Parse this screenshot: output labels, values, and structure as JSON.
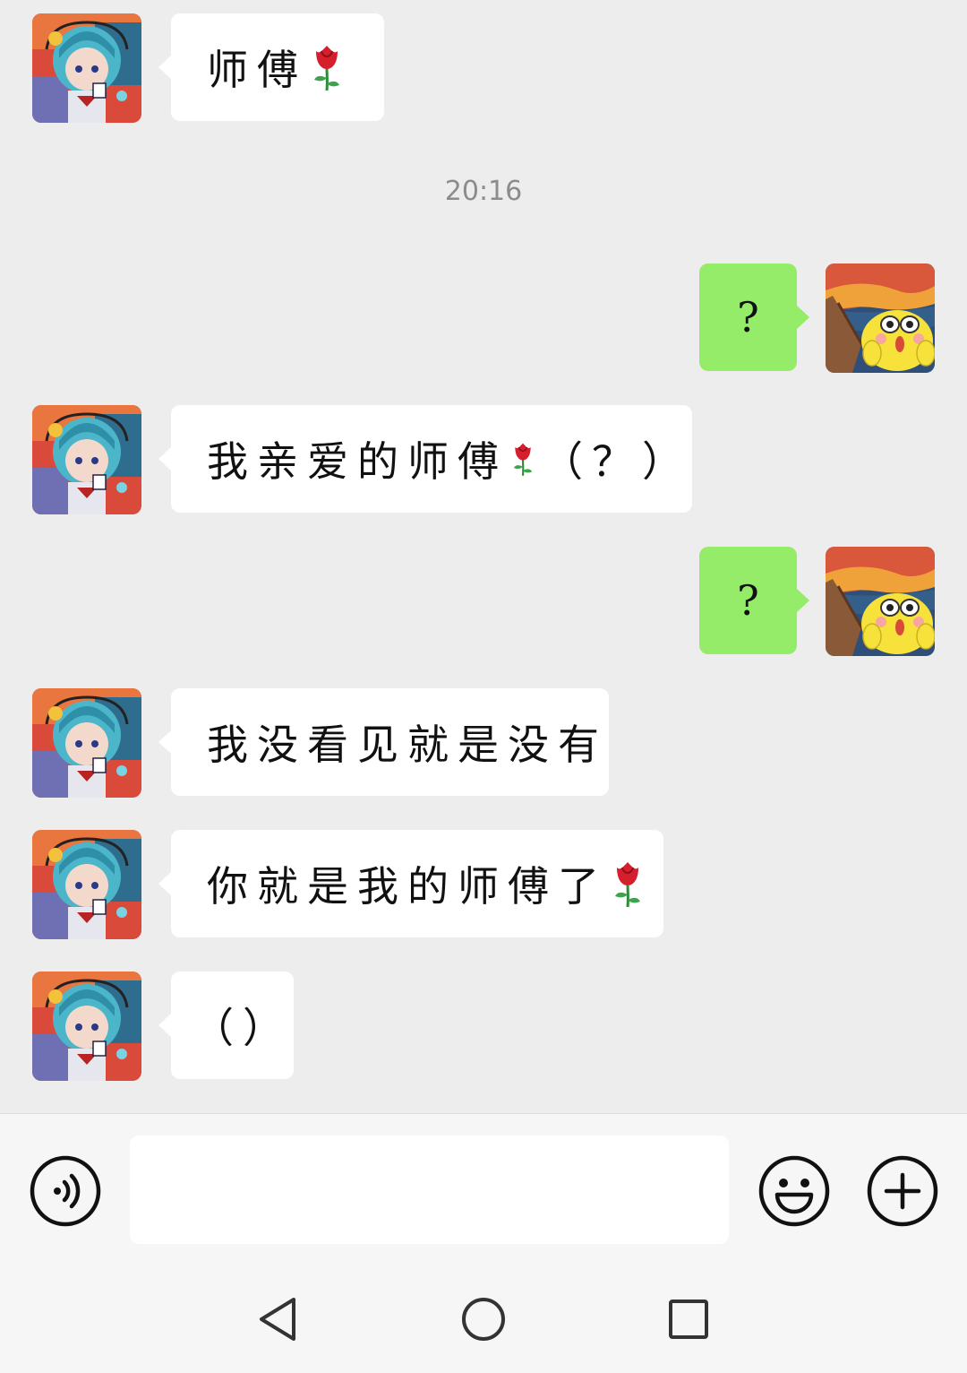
{
  "chat": {
    "timestamp": "20:16",
    "messages": [
      {
        "side": "left",
        "text": "师傅",
        "rose": true
      },
      {
        "side": "right",
        "text": "?"
      },
      {
        "side": "left",
        "text": "我亲爱的师傅",
        "rose": true,
        "suffix": "（？）"
      },
      {
        "side": "right",
        "text": "?"
      },
      {
        "side": "left",
        "text": "我没看见就是没有"
      },
      {
        "side": "left",
        "text": "你就是我的师傅了",
        "rose": true
      },
      {
        "side": "left",
        "text": "（）"
      }
    ]
  },
  "input": {
    "value": "",
    "placeholder": ""
  },
  "icons": {
    "voice": "voice-icon",
    "emoji": "emoji-icon",
    "plus": "plus-icon",
    "nav_back": "back-triangle-icon",
    "nav_home": "home-circle-icon",
    "nav_recents": "recents-square-icon",
    "rose": "rose-emoji-icon"
  },
  "colors": {
    "background": "#ededed",
    "bubble_self": "#95ec69",
    "bubble_other": "#ffffff",
    "timestamp": "#8c8c8c"
  }
}
